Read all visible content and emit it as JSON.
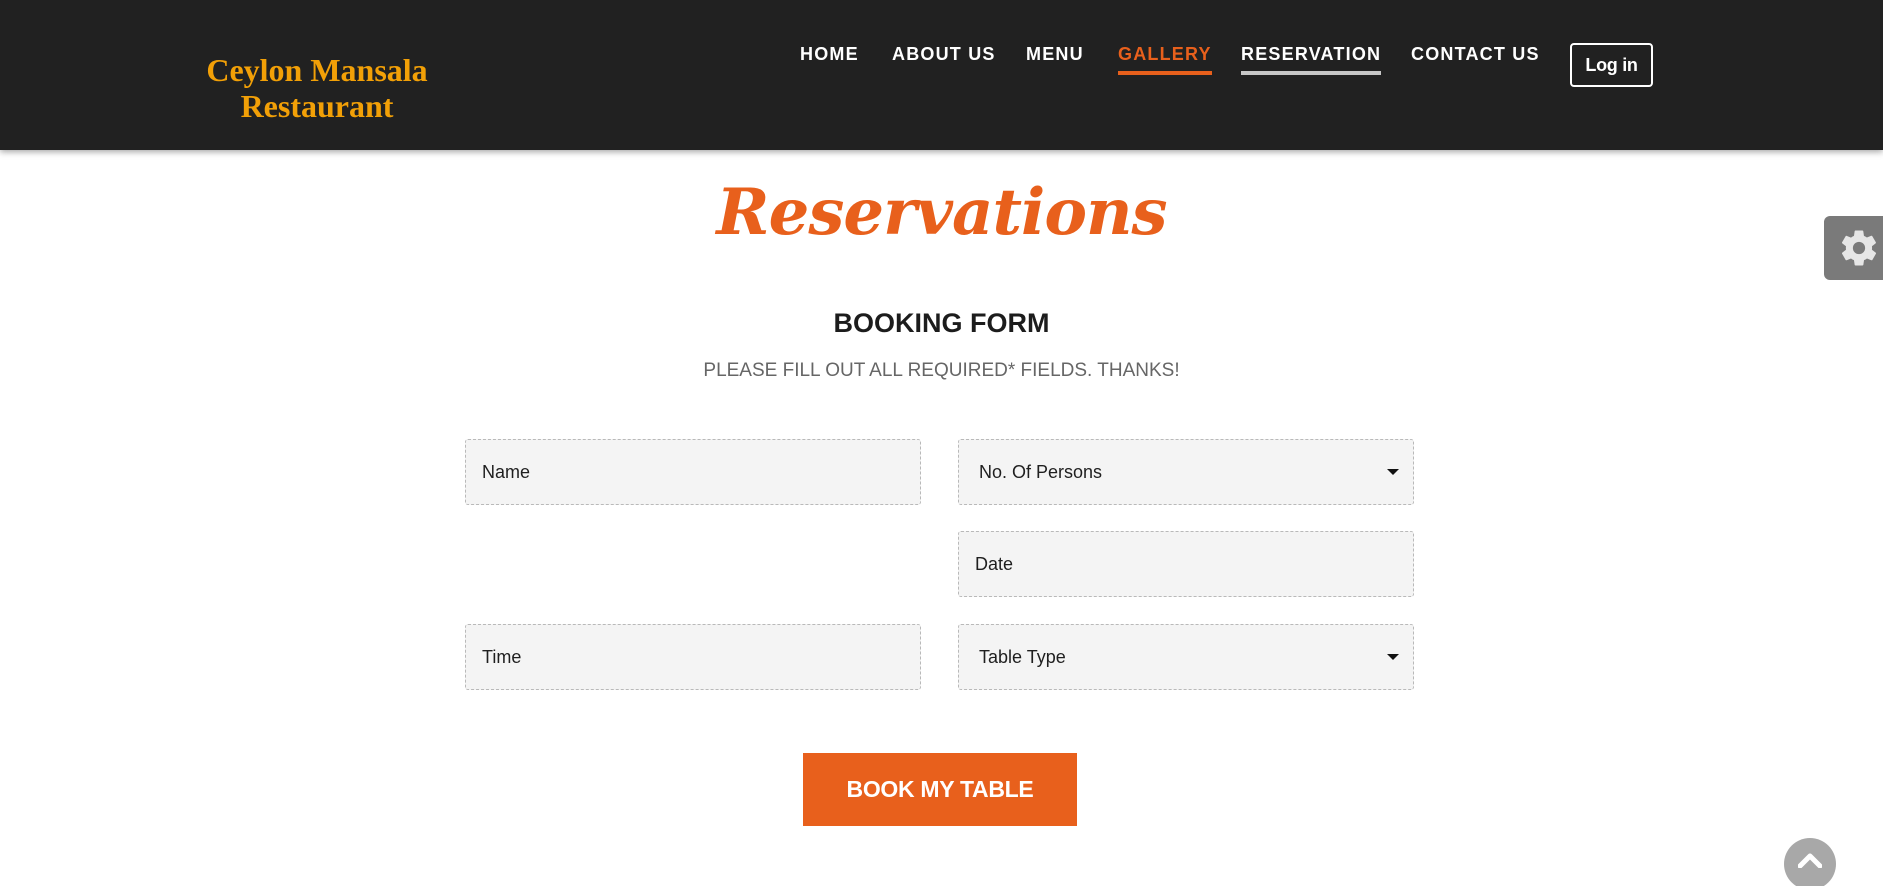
{
  "header": {
    "brand_line1": "Ceylon Mansala",
    "brand_line2": "Restaurant",
    "nav": [
      {
        "label": "HOME"
      },
      {
        "label": "ABOUT US"
      },
      {
        "label": "MENU"
      },
      {
        "label": "GALLERY",
        "state": "active"
      },
      {
        "label": "RESERVATION",
        "state": "hover"
      },
      {
        "label": "CONTACT US"
      }
    ],
    "login_label": "Log in"
  },
  "main": {
    "title": "Reservations",
    "form_heading": "BOOKING FORM",
    "form_subheading": "PLEASE FILL OUT ALL REQUIRED* FIELDS. THANKS!",
    "fields": {
      "name": {
        "placeholder": "Name"
      },
      "persons": {
        "value": "No. Of Persons"
      },
      "date": {
        "placeholder": "Date"
      },
      "time": {
        "placeholder": "Time"
      },
      "table_type": {
        "value": "Table Type"
      }
    },
    "submit_label": "BOOK MY TABLE"
  },
  "widgets": {
    "settings_icon": "gear-icon",
    "scroll_top_icon": "chevron-up-icon"
  },
  "colors": {
    "header_bg": "#212121",
    "brand": "#f2a007",
    "accent": "#e8601c",
    "hover_underline": "#c7c7c7",
    "field_bg": "#f4f4f4"
  }
}
